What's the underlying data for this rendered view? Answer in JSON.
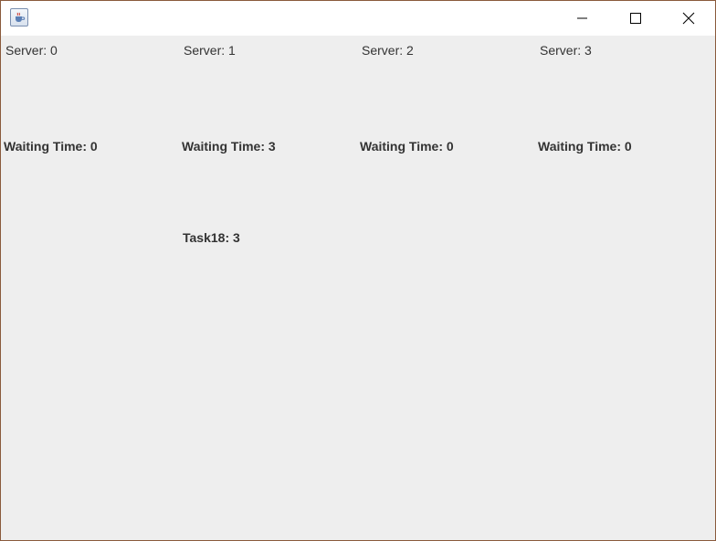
{
  "window": {
    "title": "",
    "icon": "java-cup-icon",
    "controls": [
      "minimize-icon",
      "maximize-icon",
      "close-icon"
    ]
  },
  "servers": [
    {
      "label": "Server: 0",
      "waiting": "Waiting Time: 0",
      "tasks": []
    },
    {
      "label": "Server: 1",
      "waiting": "Waiting Time: 3",
      "tasks": [
        "Task18: 3"
      ]
    },
    {
      "label": "Server: 2",
      "waiting": "Waiting Time: 0",
      "tasks": []
    },
    {
      "label": "Server: 3",
      "waiting": "Waiting Time: 0",
      "tasks": []
    }
  ]
}
